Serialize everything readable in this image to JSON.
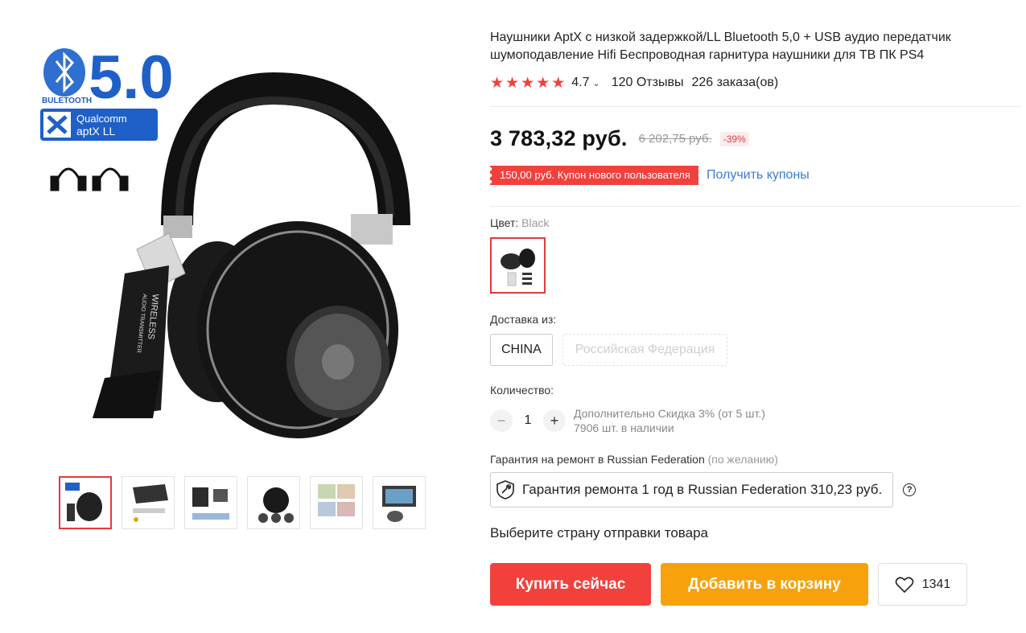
{
  "product": {
    "title": "Наушники AptX с низкой задержкой/LL Bluetooth 5,0 + USB аудио передатчик шумоподавление Hifi Беспроводная гарнитура наушники для ТВ ПК PS4",
    "rating": "4.7",
    "stars": 5,
    "reviews": "120 Отзывы",
    "orders": "226 заказа(ов)",
    "price": "3 783,32 руб.",
    "old_price": "6 202,75 руб.",
    "discount": "-39%"
  },
  "gallery": {
    "badge_version": "5.0",
    "badge_bt": "BULETOOTH",
    "badge_brand": "Qualcomm",
    "badge_codec": "aptX LL",
    "dongle_text_1": "WIRELESS",
    "dongle_text_2": "AUDIO TRANSMITTER",
    "thumbnails": [
      "thumb-1",
      "thumb-2",
      "thumb-3",
      "thumb-4",
      "thumb-5",
      "thumb-6"
    ]
  },
  "coupon": {
    "label": "150,00 руб. Купон нового пользователя",
    "link": "Получить купоны"
  },
  "color": {
    "label": "Цвет:",
    "value": "Black"
  },
  "shipping": {
    "label": "Доставка из:",
    "options": [
      "CHINA",
      "Российская Федерация"
    ]
  },
  "quantity": {
    "label": "Количество:",
    "minus": "−",
    "value": "1",
    "plus": "+",
    "extra_discount": "Дополнительно Скидка 3% (от 5 шт.)",
    "stock": "7906 шт. в наличии"
  },
  "warranty": {
    "label": "Гарантия на ремонт в Russian Federation",
    "optional": "(по желанию)",
    "option": "Гарантия ремонта 1 год в Russian Federation 310,23 руб.",
    "help": "?"
  },
  "choose_country": "Выберите страну отправки товара",
  "actions": {
    "buy": "Купить сейчас",
    "cart": "Добавить в корзину",
    "wishlist_count": "1341"
  },
  "colors": {
    "accent_red": "#f2413c",
    "accent_orange": "#f7a10c",
    "link_blue": "#3b7bd4"
  }
}
